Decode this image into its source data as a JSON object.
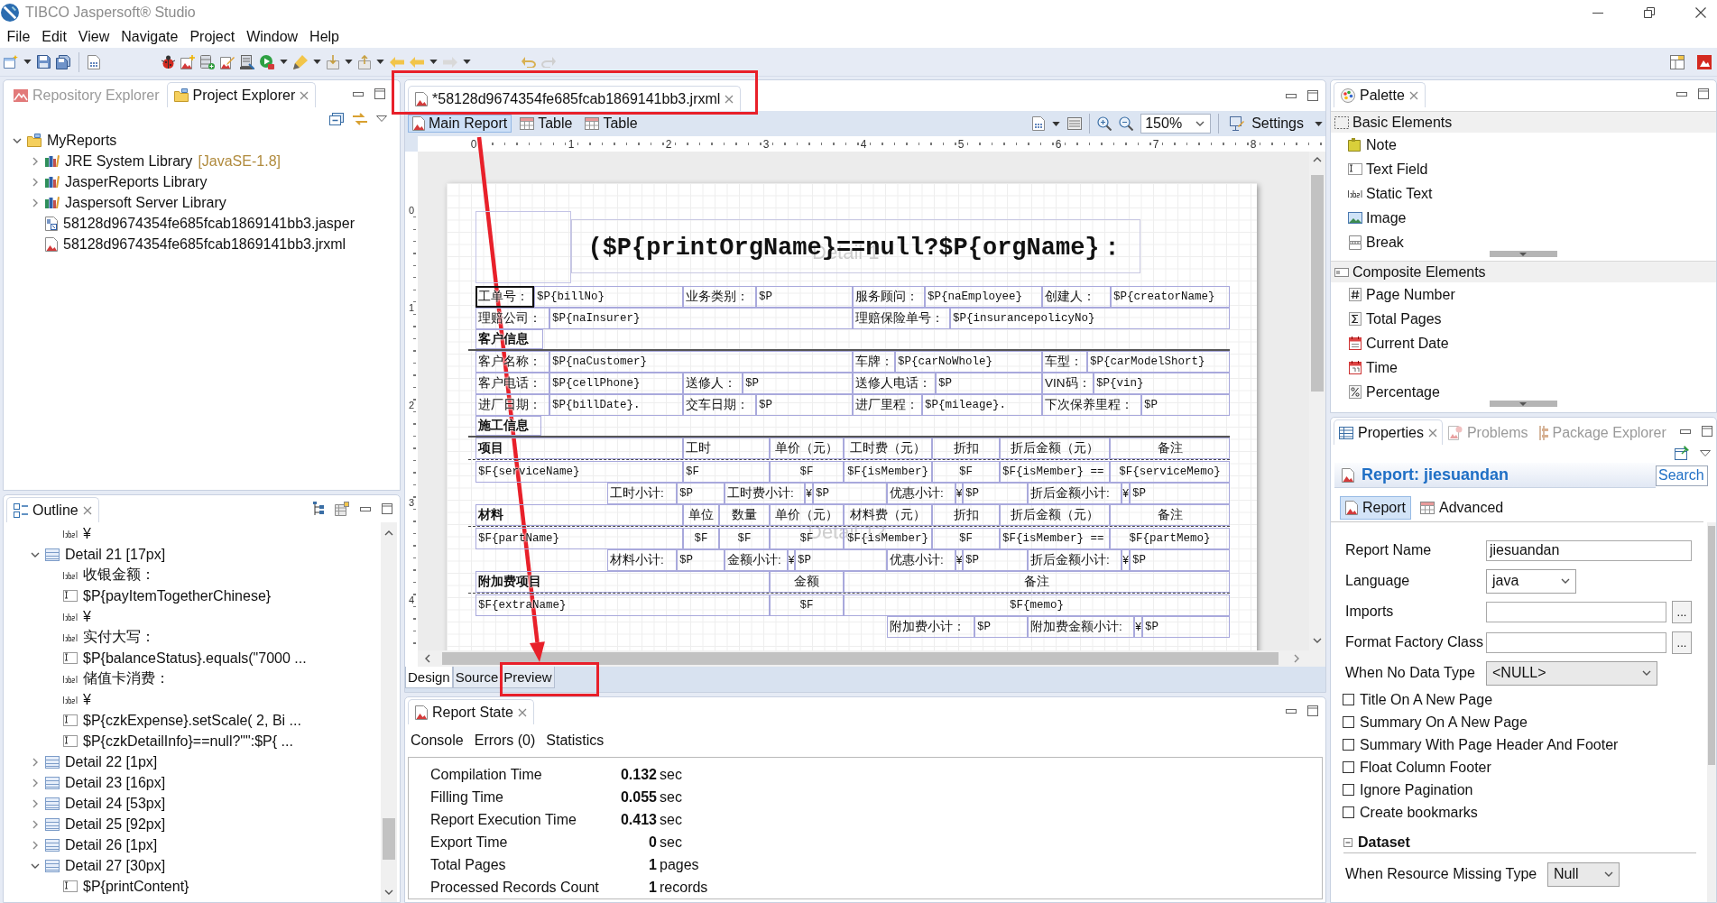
{
  "window": {
    "title": "TIBCO Jaspersoft® Studio"
  },
  "menu": [
    "File",
    "Edit",
    "View",
    "Navigate",
    "Project",
    "Window",
    "Help"
  ],
  "explorer": {
    "tabs": [
      {
        "label": "Repository Explorer",
        "selected": false
      },
      {
        "label": "Project Explorer",
        "selected": true
      }
    ],
    "tree": [
      {
        "kind": "project",
        "label": "MyReports",
        "expanded": true,
        "children": [
          {
            "kind": "library",
            "label": "JRE System Library",
            "note": "[JavaSE-1.8]",
            "expanded": false
          },
          {
            "kind": "library",
            "label": "JasperReports Library",
            "expanded": false
          },
          {
            "kind": "library",
            "label": "Jaspersoft Server Library",
            "expanded": false
          },
          {
            "kind": "jasper",
            "label": "58128d9674354fe685fcab1869141bb3.jasper"
          },
          {
            "kind": "jrxml",
            "label": "58128d9674354fe685fcab1869141bb3.jrxml"
          }
        ]
      }
    ]
  },
  "outline": {
    "title": "Outline",
    "continued": [
      {
        "kind": "label",
        "label": "¥"
      }
    ],
    "items": [
      {
        "kind": "band",
        "label": "Detail 21 [17px]",
        "expanded": true,
        "children": [
          {
            "kind": "label",
            "label": "收银金额："
          },
          {
            "kind": "textfield",
            "label": "$P{payItemTogetherChinese}"
          },
          {
            "kind": "label",
            "label": "¥"
          },
          {
            "kind": "label",
            "label": "实付大写："
          },
          {
            "kind": "textfield",
            "label": "$P{balanceStatus}.equals(\"7000 ..."
          },
          {
            "kind": "label",
            "label": "储值卡消费："
          },
          {
            "kind": "label",
            "label": "¥"
          },
          {
            "kind": "textfield",
            "label": "$P{czkExpense}.setScale( 2, Bi ..."
          },
          {
            "kind": "textfield",
            "label": "$P{czkDetailInfo}==null?\"\":$P{ ..."
          }
        ]
      },
      {
        "kind": "band",
        "label": "Detail 22 [1px]",
        "expanded": false
      },
      {
        "kind": "band",
        "label": "Detail 23 [16px]",
        "expanded": false
      },
      {
        "kind": "band",
        "label": "Detail 24 [53px]",
        "expanded": false
      },
      {
        "kind": "band",
        "label": "Detail 25 [92px]",
        "expanded": false
      },
      {
        "kind": "band",
        "label": "Detail 26 [1px]",
        "expanded": false
      },
      {
        "kind": "band",
        "label": "Detail 27 [30px]",
        "expanded": true,
        "children": [
          {
            "kind": "textfield",
            "label": "$P{printContent}"
          }
        ]
      }
    ]
  },
  "editor": {
    "tab": "*58128d9674354fe685fcab1869141bb3.jrxml",
    "views": [
      {
        "kind": "report",
        "label": "Main Report",
        "selected": true
      },
      {
        "kind": "table",
        "label": "Table",
        "selected": false
      },
      {
        "kind": "table",
        "label": "Table",
        "selected": false
      }
    ],
    "zoom": "150%",
    "settings": "Settings",
    "ruler_h": [
      "0",
      "1",
      "2",
      "3",
      "4",
      "5",
      "6",
      "7",
      "8"
    ],
    "ruler_v": [
      "0",
      "1",
      "2",
      "3",
      "4"
    ],
    "report": {
      "title": "($P{printOrgName}==null?$P{orgName}：",
      "bands": [
        "Detail 1",
        "Detail 12"
      ],
      "lines": [
        {
          "kind": "row",
          "elements": [
            {
              "kind": "label",
              "text": "工单号：",
              "selected": true
            },
            {
              "kind": "field",
              "text": "$P{billNo}",
              "selected": false
            },
            {
              "kind": "label",
              "text": "业务类别：",
              "selected": false
            },
            {
              "kind": "field",
              "text": "$P",
              "selected": false
            },
            {
              "kind": "label",
              "text": "服务顾问：",
              "selected": false
            },
            {
              "kind": "field",
              "text": "$P{naEmployee}",
              "selected": false
            },
            {
              "kind": "label",
              "text": "创建人：",
              "selected": false
            },
            {
              "kind": "field",
              "text": "$P{creatorName}",
              "selected": false
            }
          ]
        },
        {
          "kind": "row",
          "elements": [
            {
              "kind": "label",
              "text": "理赔公司：",
              "selected": false
            },
            {
              "kind": "field",
              "text": "$P{naInsurer}",
              "selected": false
            },
            {
              "kind": "label",
              "text": "理赔保险单号：",
              "selected": false
            },
            {
              "kind": "field",
              "text": "$P{insurancepolicyNo}",
              "selected": false
            }
          ]
        },
        {
          "kind": "section",
          "elements": [
            {
              "kind": "heading",
              "text": "客户信息",
              "selected": false
            }
          ]
        },
        {
          "kind": "row",
          "elements": [
            {
              "kind": "label",
              "text": "客户名称：",
              "selected": false
            },
            {
              "kind": "field",
              "text": "$P{naCustomer}",
              "selected": false
            },
            {
              "kind": "label",
              "text": "车牌：",
              "selected": false
            },
            {
              "kind": "field",
              "text": "$P{carNoWhole}",
              "selected": false
            },
            {
              "kind": "label",
              "text": "车型：",
              "selected": false
            },
            {
              "kind": "field",
              "text": "$P{carModelShort}",
              "selected": false
            }
          ]
        },
        {
          "kind": "row",
          "elements": [
            {
              "kind": "label",
              "text": "客户电话：",
              "selected": false
            },
            {
              "kind": "field",
              "text": "$P{cellPhone}",
              "selected": false
            },
            {
              "kind": "label",
              "text": "送修人：",
              "selected": false
            },
            {
              "kind": "field",
              "text": "$P",
              "selected": false
            },
            {
              "kind": "label",
              "text": "送修人电话：",
              "selected": false
            },
            {
              "kind": "field",
              "text": "$P",
              "selected": false
            },
            {
              "kind": "label",
              "text": "VIN码：",
              "selected": false
            },
            {
              "kind": "field",
              "text": "$P{vin}",
              "selected": false
            }
          ]
        },
        {
          "kind": "row",
          "elements": [
            {
              "kind": "label",
              "text": "进厂日期：",
              "selected": false
            },
            {
              "kind": "field",
              "text": "$P{billDate}.",
              "selected": false
            },
            {
              "kind": "label",
              "text": "交车日期：",
              "selected": false
            },
            {
              "kind": "field",
              "text": "$P",
              "selected": false
            },
            {
              "kind": "label",
              "text": "进厂里程：",
              "selected": false
            },
            {
              "kind": "field",
              "text": "$P{mileage}.",
              "selected": false
            },
            {
              "kind": "label",
              "text": "下次保养里程：",
              "selected": false
            },
            {
              "kind": "field",
              "text": "$P",
              "selected": false
            }
          ]
        },
        {
          "kind": "section",
          "elements": [
            {
              "kind": "heading",
              "text": "施工信息",
              "selected": false
            }
          ]
        },
        {
          "kind": "header",
          "elements": [
            {
              "kind": "heading",
              "text": "项目",
              "selected": false
            },
            {
              "kind": "label",
              "text": "工时",
              "selected": false
            },
            {
              "kind": "column",
              "text": "单价（元）",
              "selected": false
            },
            {
              "kind": "column",
              "text": "工时费（元）",
              "selected": false
            },
            {
              "kind": "column",
              "text": "折扣",
              "selected": false
            },
            {
              "kind": "column",
              "text": "折后金额（元）",
              "selected": false
            },
            {
              "kind": "column",
              "text": "备注",
              "selected": false
            }
          ]
        },
        {
          "kind": "row",
          "elements": [
            {
              "kind": "field",
              "text": "$F{serviceName}",
              "selected": false
            },
            {
              "kind": "field",
              "text": "$F",
              "selected": false
            },
            {
              "kind": "number",
              "text": "$F",
              "selected": false
            },
            {
              "kind": "number",
              "text": "$F{isMember}",
              "selected": false
            },
            {
              "kind": "number",
              "text": "$F",
              "selected": false
            },
            {
              "kind": "field",
              "text": "$F{isMember} ==",
              "selected": false
            },
            {
              "kind": "number",
              "text": "$F{serviceMemo}",
              "selected": false
            }
          ]
        },
        {
          "kind": "row",
          "elements": [
            {
              "kind": "label",
              "text": "工时小计:",
              "selected": false
            },
            {
              "kind": "field",
              "text": "$P",
              "selected": false
            },
            {
              "kind": "label",
              "text": "工时费小计:",
              "selected": false
            },
            {
              "kind": "mark",
              "text": "¥",
              "selected": false
            },
            {
              "kind": "field",
              "text": "$P",
              "selected": false
            },
            {
              "kind": "label",
              "text": "优惠小计:",
              "selected": false
            },
            {
              "kind": "mark",
              "text": "¥",
              "selected": false
            },
            {
              "kind": "field",
              "text": "$P",
              "selected": false
            },
            {
              "kind": "label",
              "text": "折后金额小计:",
              "selected": false
            },
            {
              "kind": "mark",
              "text": "¥",
              "selected": false
            },
            {
              "kind": "field",
              "text": "$P",
              "selected": false
            }
          ]
        },
        {
          "kind": "header",
          "elements": [
            {
              "kind": "heading",
              "text": "材料",
              "selected": false
            },
            {
              "kind": "column",
              "text": "单位",
              "selected": false
            },
            {
              "kind": "column",
              "text": "数量",
              "selected": false
            },
            {
              "kind": "column",
              "text": "单价（元）",
              "selected": false
            },
            {
              "kind": "column",
              "text": "材料费（元）",
              "selected": false
            },
            {
              "kind": "column",
              "text": "折扣",
              "selected": false
            },
            {
              "kind": "column",
              "text": "折后金额（元）",
              "selected": false
            },
            {
              "kind": "column",
              "text": "备注",
              "selected": false
            }
          ]
        },
        {
          "kind": "row",
          "elements": [
            {
              "kind": "field",
              "text": "$F{partName}",
              "selected": false
            },
            {
              "kind": "number",
              "text": "$F",
              "selected": false
            },
            {
              "kind": "number",
              "text": "$F",
              "selected": false
            },
            {
              "kind": "number",
              "text": "$F",
              "selected": false
            },
            {
              "kind": "number",
              "text": "$F{isMember}",
              "selected": false
            },
            {
              "kind": "number",
              "text": "$F",
              "selected": false
            },
            {
              "kind": "field",
              "text": "$F{isMember} ==",
              "selected": false
            },
            {
              "kind": "number",
              "text": "$F{partMemo}",
              "selected": false
            }
          ]
        },
        {
          "kind": "row",
          "elements": [
            {
              "kind": "label",
              "text": "材料小计:",
              "selected": false
            },
            {
              "kind": "field",
              "text": "$P",
              "selected": false
            },
            {
              "kind": "label",
              "text": "金额小计:",
              "selected": false
            },
            {
              "kind": "mark",
              "text": "¥",
              "selected": false
            },
            {
              "kind": "field",
              "text": "$P",
              "selected": false
            },
            {
              "kind": "label",
              "text": "优惠小计:",
              "selected": false
            },
            {
              "kind": "mark",
              "text": "¥",
              "selected": false
            },
            {
              "kind": "field",
              "text": "$P",
              "selected": false
            },
            {
              "kind": "label",
              "text": "折后金额小计:",
              "selected": false
            },
            {
              "kind": "mark",
              "text": "¥",
              "selected": false
            },
            {
              "kind": "field",
              "text": "$P",
              "selected": false
            }
          ]
        },
        {
          "kind": "header",
          "elements": [
            {
              "kind": "heading",
              "text": "附加费项目",
              "selected": false
            },
            {
              "kind": "column",
              "text": "金额",
              "selected": false
            },
            {
              "kind": "column",
              "text": "备注",
              "selected": false
            }
          ]
        },
        {
          "kind": "row",
          "elements": [
            {
              "kind": "field",
              "text": "$F{extraName}",
              "selected": false
            },
            {
              "kind": "number",
              "text": "$F",
              "selected": false
            },
            {
              "kind": "number",
              "text": "$F{memo}",
              "selected": false
            }
          ]
        },
        {
          "kind": "row",
          "elements": [
            {
              "kind": "label",
              "text": "附加费小计：",
              "selected": false
            },
            {
              "kind": "field",
              "text": "$P",
              "selected": false
            },
            {
              "kind": "label",
              "text": "附加费金额小计:",
              "selected": false
            },
            {
              "kind": "mark",
              "text": "¥",
              "selected": false
            },
            {
              "kind": "field",
              "text": "$P",
              "selected": false
            }
          ]
        }
      ]
    },
    "modes": [
      {
        "label": "Design",
        "selected": true
      },
      {
        "label": "Source",
        "selected": false
      },
      {
        "label": "Preview",
        "selected": false
      }
    ]
  },
  "report_state": {
    "title": "Report State",
    "tabs": [
      "Console",
      "Errors (0)",
      "Statistics"
    ],
    "stats": [
      {
        "label": "Compilation Time",
        "value": "0.132",
        "unit": "sec"
      },
      {
        "label": "Filling Time",
        "value": "0.055",
        "unit": "sec"
      },
      {
        "label": "Report Execution Time",
        "value": "0.413",
        "unit": "sec"
      },
      {
        "label": "Export Time",
        "value": "0",
        "unit": "sec"
      },
      {
        "label": "Total Pages",
        "value": "1",
        "unit": "pages"
      },
      {
        "label": "Processed Records Count",
        "value": "1",
        "unit": "records"
      }
    ]
  },
  "palette": {
    "title": "Palette",
    "groups": [
      {
        "label": "Basic Elements",
        "items": [
          {
            "kind": "note",
            "label": "Note"
          },
          {
            "kind": "textfield",
            "label": "Text Field"
          },
          {
            "kind": "statictext",
            "label": "Static Text"
          },
          {
            "kind": "image",
            "label": "Image"
          },
          {
            "kind": "break",
            "label": "Break"
          }
        ]
      },
      {
        "label": "Composite Elements",
        "items": [
          {
            "kind": "pagenumber",
            "label": "Page Number"
          },
          {
            "kind": "totalpages",
            "label": "Total Pages"
          },
          {
            "kind": "date",
            "label": "Current Date"
          },
          {
            "kind": "time",
            "label": "Time"
          },
          {
            "kind": "percentage",
            "label": "Percentage"
          }
        ]
      }
    ]
  },
  "properties": {
    "tabs": [
      {
        "label": "Properties",
        "selected": true
      },
      {
        "label": "Problems",
        "selected": false
      },
      {
        "label": "Package Explorer",
        "selected": false
      }
    ],
    "heading": "Report: jiesuandan",
    "search": {
      "placeholder": "Search"
    },
    "subtabs": [
      {
        "label": "Report",
        "selected": true
      },
      {
        "label": "Advanced",
        "selected": false
      }
    ],
    "fields": [
      {
        "kind": "text",
        "label": "Report Name",
        "value": "jiesuandan"
      },
      {
        "kind": "combo",
        "label": "Language",
        "value": "java"
      },
      {
        "kind": "browse",
        "label": "Imports",
        "button": "..."
      },
      {
        "kind": "browse",
        "label": "Format Factory Class",
        "button": "..."
      },
      {
        "kind": "combo",
        "label": "When No Data Type",
        "value": "<NULL>"
      }
    ],
    "options": [
      {
        "label": "Title On A New Page",
        "checked": false
      },
      {
        "label": "Summary On A New Page",
        "checked": false
      },
      {
        "label": "Summary With Page Header And Footer",
        "checked": false
      },
      {
        "label": "Float Column Footer",
        "checked": false
      },
      {
        "label": "Ignore Pagination",
        "checked": false
      },
      {
        "label": "Create bookmarks",
        "checked": false
      }
    ],
    "dataset": {
      "label": "Dataset",
      "expanded": true,
      "fields": [
        {
          "kind": "combo",
          "label": "When Resource Missing Type",
          "value": "Null"
        }
      ]
    }
  },
  "annotations": [
    {
      "kind": "frame"
    },
    {
      "kind": "arrow"
    },
    {
      "kind": "frame"
    }
  ]
}
